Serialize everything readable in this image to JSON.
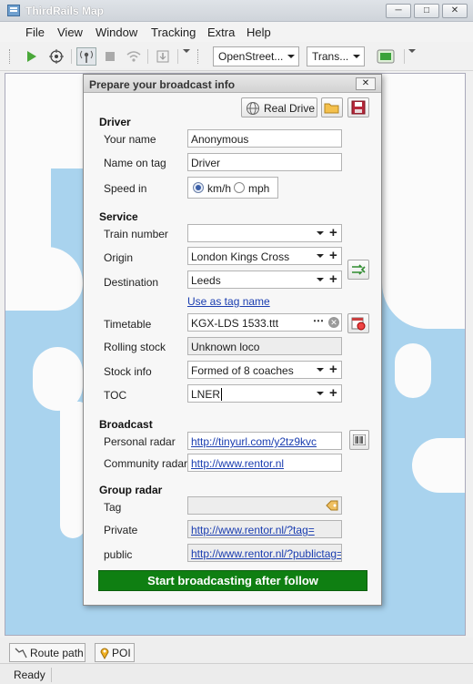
{
  "app": {
    "title": "ThirdRails Map",
    "window_buttons": [
      "minimize",
      "maximize",
      "close"
    ]
  },
  "menu": [
    "File",
    "View",
    "Window",
    "Tracking",
    "Extra",
    "Help"
  ],
  "toolbar": {
    "map_source": "OpenStreet...",
    "transport": "Trans...",
    "icons": [
      "play-icon",
      "target-icon",
      "broadcast-icon",
      "stop-icon",
      "wifi-icon",
      "export-icon",
      "layers-icon"
    ]
  },
  "dialog": {
    "title": "Prepare your broadcast info",
    "real_drive_label": "Real Drive",
    "driver": {
      "heading": "Driver",
      "name_label": "Your name",
      "name_value": "Anonymous",
      "tag_label": "Name on tag",
      "tag_value": "Driver",
      "speed_label": "Speed in",
      "speed_options": [
        "km/h",
        "mph"
      ],
      "speed_selected": "km/h"
    },
    "service": {
      "heading": "Service",
      "train_number_label": "Train number",
      "train_number_value": "",
      "origin_label": "Origin",
      "origin_value": "London Kings Cross",
      "destination_label": "Destination",
      "destination_value": "Leeds",
      "use_as_tag_label": "Use as tag name",
      "timetable_label": "Timetable",
      "timetable_value": "KGX-LDS 1533.ttt",
      "rolling_stock_label": "Rolling stock",
      "rolling_stock_value": "Unknown loco",
      "stock_info_label": "Stock info",
      "stock_info_value": "Formed of 8 coaches",
      "toc_label": "TOC",
      "toc_value": "LNER"
    },
    "broadcast": {
      "heading": "Broadcast",
      "personal_label": "Personal radar",
      "personal_value": "http://tinyurl.com/y2tz9kvc",
      "community_label": "Community radar",
      "community_value": "http://www.rentor.nl"
    },
    "group": {
      "heading": "Group radar",
      "tag_label": "Tag",
      "tag_value": "",
      "private_label": "Private",
      "private_value": "http://www.rentor.nl/?tag=",
      "public_label": "public",
      "public_value": "http://www.rentor.nl/?publictag="
    },
    "start_label": "Start broadcasting after follow"
  },
  "bottom_tabs": [
    "Route path",
    "POI"
  ],
  "status": "Ready",
  "colors": {
    "start_button": "#0f7f12",
    "map_water": "#a9d3ee",
    "link": "#1a3db0"
  }
}
